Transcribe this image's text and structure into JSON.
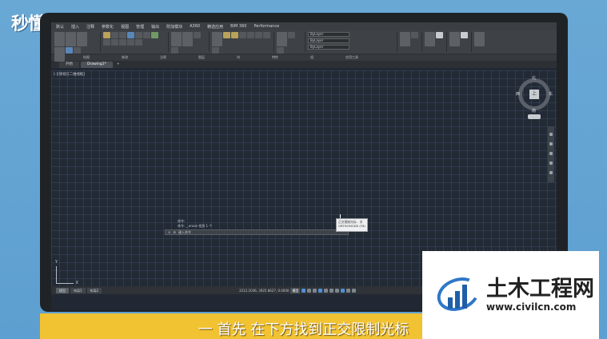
{
  "brand": {
    "text": "秒懂视频"
  },
  "menubar": {
    "items": [
      "默认",
      "插入",
      "注释",
      "参数化",
      "视图",
      "管理",
      "输出",
      "附加模块",
      "A360",
      "精选应用",
      "BIM 360",
      "Performance"
    ]
  },
  "ribbon": {
    "groups": [
      "绘图",
      "修改",
      "注释",
      "图层",
      "块",
      "特性",
      "组",
      "实用工具",
      "剪贴板",
      "视图"
    ],
    "labels": {
      "line": "直线",
      "polyline": "多段线",
      "circle": "圆",
      "arc": "圆弧",
      "text": "文字",
      "dimension": "标注",
      "layer_props": "图层特性",
      "insert": "插入",
      "match": "特性匹配",
      "group": "组",
      "measure": "测量",
      "paste": "粘贴",
      "base": "基点"
    },
    "layer_combo": "ByLayer",
    "linetype_combo": "ByLayer",
    "lineweight_combo": "ByLayer"
  },
  "tabs": [
    {
      "label": "开始"
    },
    {
      "label": "Drawing1*"
    },
    {
      "label": "+"
    }
  ],
  "viewport": {
    "label": "[-][俯视][二维线框]"
  },
  "viewcube": {
    "top_face": "上",
    "north": "北",
    "south": "南",
    "east": "东",
    "west": "西",
    "wcs": "WCS"
  },
  "ucs": {
    "x": "X",
    "y": "Y"
  },
  "command": {
    "history_1": "命令:",
    "history_2": "命令: _.erase 找到 1 个",
    "placeholder": "键入命令"
  },
  "tooltip": {
    "line1": "正交限制光标 - 关",
    "line2": "ORTHOMODE (F8)"
  },
  "status": {
    "tabs": [
      "模型",
      "布局1",
      "布局2"
    ],
    "coords": "2212.2036, 3925.8627, 0.0000",
    "model": "模型"
  },
  "subtitle": "一 首先 在下方找到正交限制光标",
  "watermark": {
    "cn": "土木工程网",
    "url": "www.civilcn.com"
  }
}
